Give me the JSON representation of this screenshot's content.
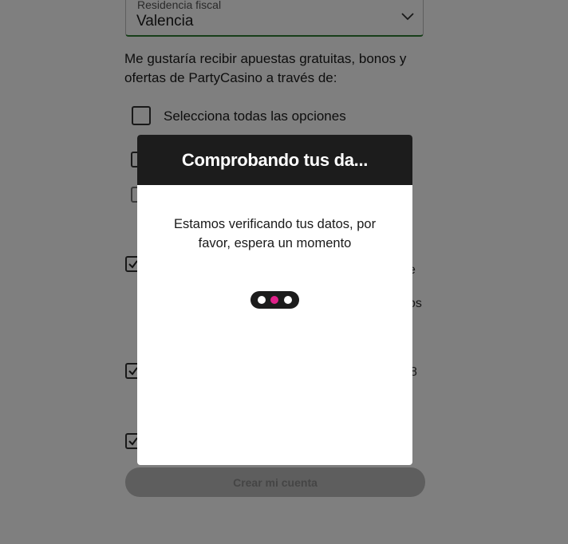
{
  "form": {
    "tax_residence": {
      "label": "Residencia fiscal",
      "value": "Valencia"
    },
    "consent_text": "Me gustaría recibir apuestas gratuitas, bonos y ofertas de PartyCasino a través de:",
    "select_all_label": "Selecciona todas las opciones",
    "partial_text": {
      "a": "e",
      "b": "os",
      "c": "8"
    },
    "create_account_button": "Crear mi cuenta"
  },
  "modal": {
    "title": "Comprobando tus da...",
    "message": "Estamos verificando tus datos, por favor, espera un momento",
    "loader_active_color": "#e0218a"
  },
  "colors": {
    "field_underline": "#2e7d32",
    "modal_header_bg": "#1c1c1c"
  }
}
